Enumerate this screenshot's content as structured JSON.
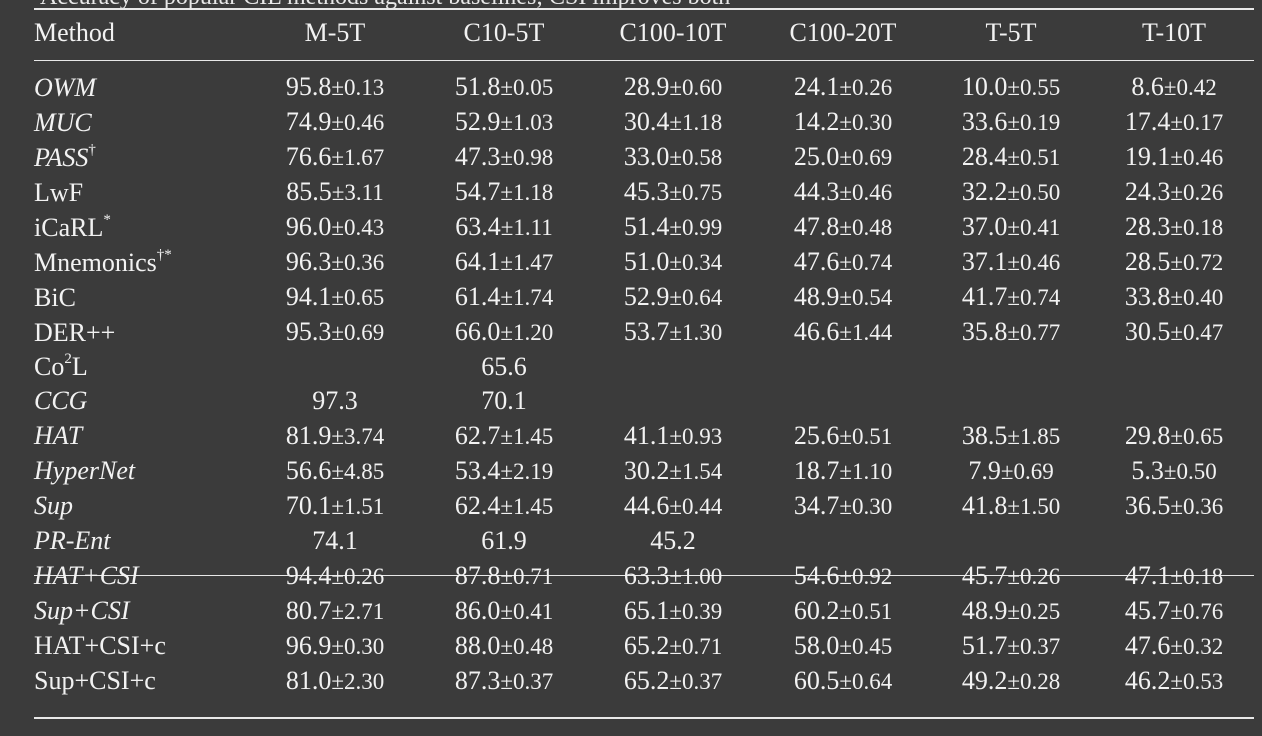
{
  "caption_fragment": "Accuracy of popular CIL methods against baselines; CSI improves both",
  "table": {
    "headers": [
      "Method",
      "M-5T",
      "C10-5T",
      "C100-10T",
      "C100-20T",
      "T-5T",
      "T-10T"
    ],
    "rows": [
      {
        "name": "OWM",
        "italic": true,
        "sup": "",
        "cells": [
          [
            "95.8",
            "0.13"
          ],
          [
            "51.8",
            "0.05"
          ],
          [
            "28.9",
            "0.60"
          ],
          [
            "24.1",
            "0.26"
          ],
          [
            "10.0",
            "0.55"
          ],
          [
            "8.6",
            "0.42"
          ]
        ]
      },
      {
        "name": "MUC",
        "italic": true,
        "sup": "",
        "cells": [
          [
            "74.9",
            "0.46"
          ],
          [
            "52.9",
            "1.03"
          ],
          [
            "30.4",
            "1.18"
          ],
          [
            "14.2",
            "0.30"
          ],
          [
            "33.6",
            "0.19"
          ],
          [
            "17.4",
            "0.17"
          ]
        ]
      },
      {
        "name": "PASS",
        "italic": true,
        "sup": "†",
        "cells": [
          [
            "76.6",
            "1.67"
          ],
          [
            "47.3",
            "0.98"
          ],
          [
            "33.0",
            "0.58"
          ],
          [
            "25.0",
            "0.69"
          ],
          [
            "28.4",
            "0.51"
          ],
          [
            "19.1",
            "0.46"
          ]
        ]
      },
      {
        "name": "LwF",
        "italic": false,
        "sup": "",
        "cells": [
          [
            "85.5",
            "3.11"
          ],
          [
            "54.7",
            "1.18"
          ],
          [
            "45.3",
            "0.75"
          ],
          [
            "44.3",
            "0.46"
          ],
          [
            "32.2",
            "0.50"
          ],
          [
            "24.3",
            "0.26"
          ]
        ]
      },
      {
        "name": "iCaRL",
        "italic": false,
        "sup": "*",
        "cells": [
          [
            "96.0",
            "0.43"
          ],
          [
            "63.4",
            "1.11"
          ],
          [
            "51.4",
            "0.99"
          ],
          [
            "47.8",
            "0.48"
          ],
          [
            "37.0",
            "0.41"
          ],
          [
            "28.3",
            "0.18"
          ]
        ]
      },
      {
        "name": "Mnemonics",
        "italic": false,
        "sup": "†*",
        "cells": [
          [
            "96.3",
            "0.36"
          ],
          [
            "64.1",
            "1.47"
          ],
          [
            "51.0",
            "0.34"
          ],
          [
            "47.6",
            "0.74"
          ],
          [
            "37.1",
            "0.46"
          ],
          [
            "28.5",
            "0.72"
          ]
        ]
      },
      {
        "name": "BiC",
        "italic": false,
        "sup": "",
        "cells": [
          [
            "94.1",
            "0.65"
          ],
          [
            "61.4",
            "1.74"
          ],
          [
            "52.9",
            "0.64"
          ],
          [
            "48.9",
            "0.54"
          ],
          [
            "41.7",
            "0.74"
          ],
          [
            "33.8",
            "0.40"
          ]
        ]
      },
      {
        "name": "DER++",
        "italic": false,
        "sup": "",
        "cells": [
          [
            "95.3",
            "0.69"
          ],
          [
            "66.0",
            "1.20"
          ],
          [
            "53.7",
            "1.30"
          ],
          [
            "46.6",
            "1.44"
          ],
          [
            "35.8",
            "0.77"
          ],
          [
            "30.5",
            "0.47"
          ]
        ]
      },
      {
        "name": "Co",
        "italic": false,
        "sup": "2",
        "suffix": "L",
        "cells": [
          [
            "",
            ""
          ],
          [
            "65.6",
            ""
          ],
          [
            "",
            ""
          ],
          [
            "",
            ""
          ],
          [
            "",
            ""
          ],
          [
            "",
            ""
          ]
        ]
      },
      {
        "name": "CCG",
        "italic": true,
        "sup": "",
        "cells": [
          [
            "97.3",
            ""
          ],
          [
            "70.1",
            ""
          ],
          [
            "",
            ""
          ],
          [
            "",
            ""
          ],
          [
            "",
            ""
          ],
          [
            "",
            ""
          ]
        ]
      },
      {
        "name": "HAT",
        "italic": true,
        "sup": "",
        "cells": [
          [
            "81.9",
            "3.74"
          ],
          [
            "62.7",
            "1.45"
          ],
          [
            "41.1",
            "0.93"
          ],
          [
            "25.6",
            "0.51"
          ],
          [
            "38.5",
            "1.85"
          ],
          [
            "29.8",
            "0.65"
          ]
        ]
      },
      {
        "name": "HyperNet",
        "italic": true,
        "sup": "",
        "cells": [
          [
            "56.6",
            "4.85"
          ],
          [
            "53.4",
            "2.19"
          ],
          [
            "30.2",
            "1.54"
          ],
          [
            "18.7",
            "1.10"
          ],
          [
            "7.9",
            "0.69"
          ],
          [
            "5.3",
            "0.50"
          ]
        ]
      },
      {
        "name": "Sup",
        "italic": true,
        "sup": "",
        "cells": [
          [
            "70.1",
            "1.51"
          ],
          [
            "62.4",
            "1.45"
          ],
          [
            "44.6",
            "0.44"
          ],
          [
            "34.7",
            "0.30"
          ],
          [
            "41.8",
            "1.50"
          ],
          [
            "36.5",
            "0.36"
          ]
        ]
      },
      {
        "name": "PR-Ent",
        "italic": true,
        "sup": "",
        "cells": [
          [
            "74.1",
            ""
          ],
          [
            "61.9",
            ""
          ],
          [
            "45.2",
            ""
          ],
          [
            "",
            ""
          ],
          [
            "",
            ""
          ],
          [
            "",
            ""
          ]
        ]
      }
    ],
    "rows2": [
      {
        "name": "HAT+CSI",
        "italic": true,
        "sup": "",
        "cells": [
          [
            "94.4",
            "0.26"
          ],
          [
            "87.8",
            "0.71"
          ],
          [
            "63.3",
            "1.00"
          ],
          [
            "54.6",
            "0.92"
          ],
          [
            "45.7",
            "0.26"
          ],
          [
            "47.1",
            "0.18"
          ]
        ]
      },
      {
        "name": "Sup+CSI",
        "italic": true,
        "sup": "",
        "cells": [
          [
            "80.7",
            "2.71"
          ],
          [
            "86.0",
            "0.41"
          ],
          [
            "65.1",
            "0.39"
          ],
          [
            "60.2",
            "0.51"
          ],
          [
            "48.9",
            "0.25"
          ],
          [
            "45.7",
            "0.76"
          ]
        ]
      },
      {
        "name": "HAT+CSI+c",
        "italic": false,
        "sup": "",
        "cells": [
          [
            "96.9",
            "0.30"
          ],
          [
            "88.0",
            "0.48"
          ],
          [
            "65.2",
            "0.71"
          ],
          [
            "58.0",
            "0.45"
          ],
          [
            "51.7",
            "0.37"
          ],
          [
            "47.6",
            "0.32"
          ]
        ]
      },
      {
        "name": "Sup+CSI+c",
        "italic": false,
        "sup": "",
        "cells": [
          [
            "81.0",
            "2.30"
          ],
          [
            "87.3",
            "0.37"
          ],
          [
            "65.2",
            "0.37"
          ],
          [
            "60.5",
            "0.64"
          ],
          [
            "49.2",
            "0.28"
          ],
          [
            "46.2",
            "0.53"
          ]
        ]
      }
    ]
  }
}
